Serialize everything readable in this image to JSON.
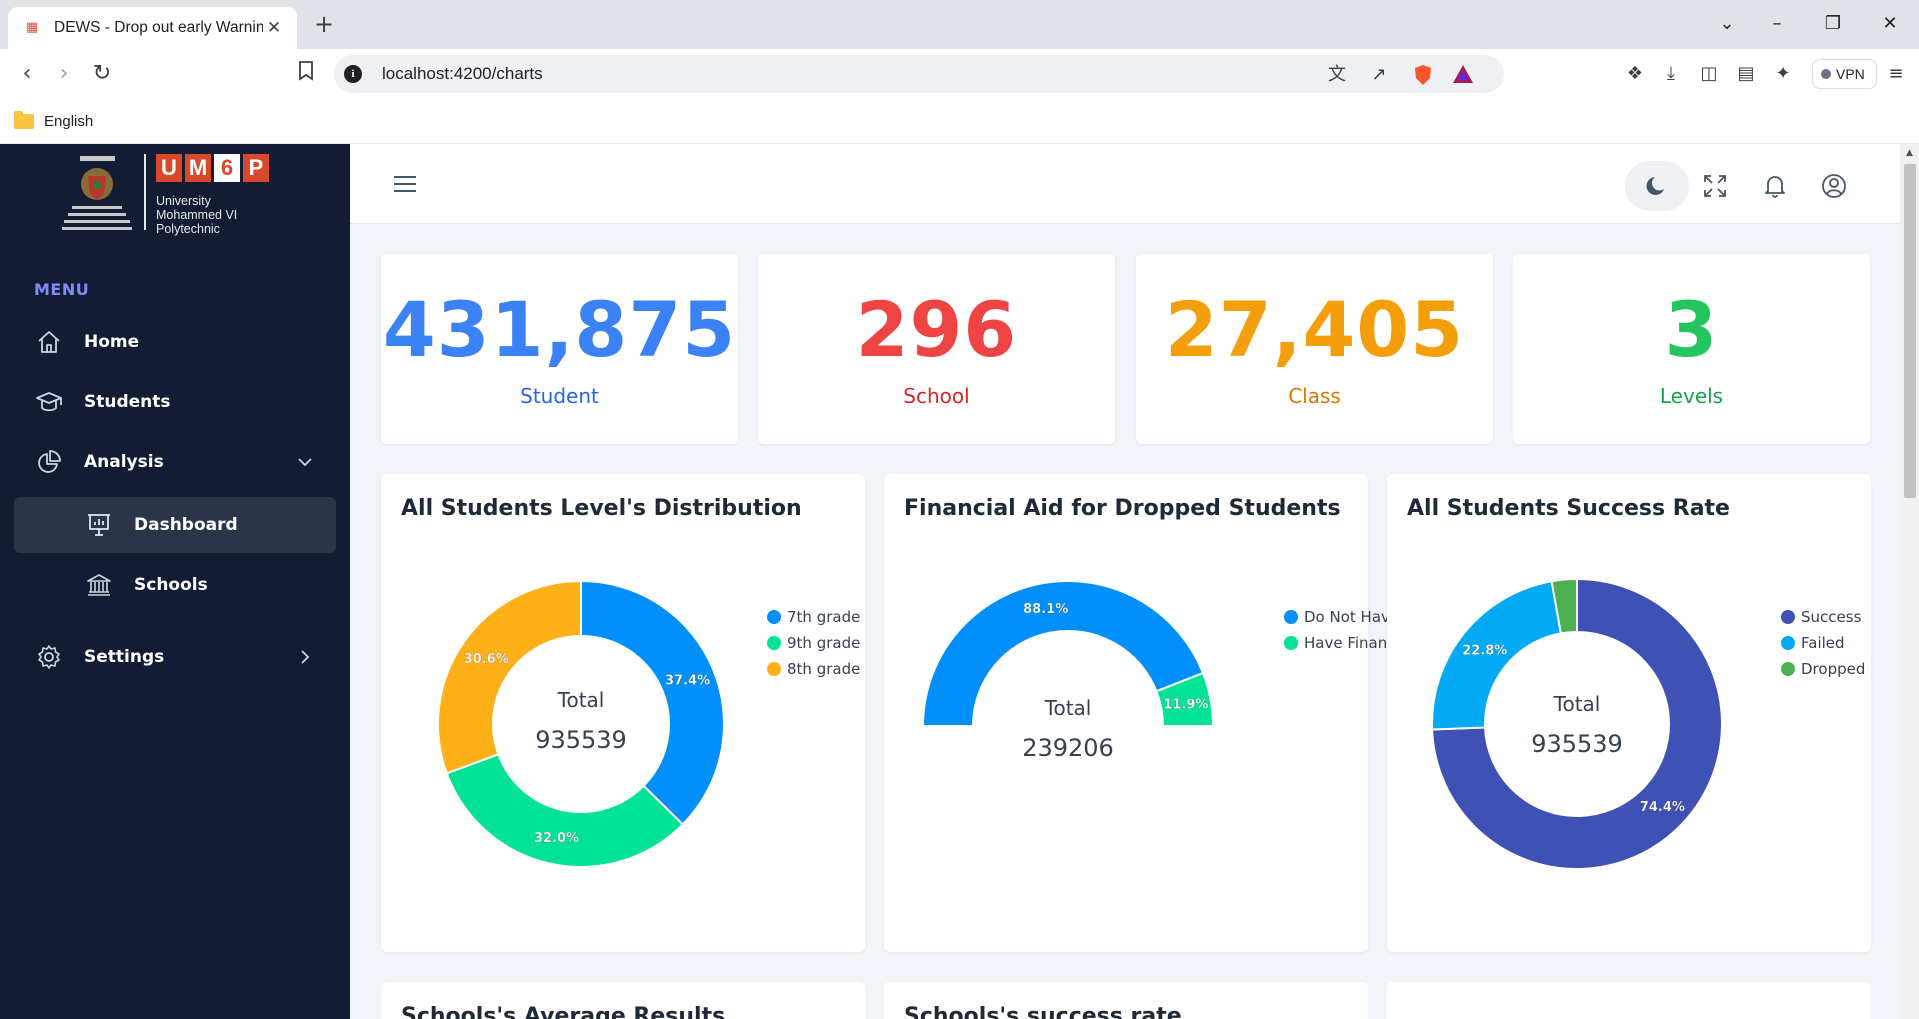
{
  "browser": {
    "tab_title": "DEWS - Drop out early Warning",
    "url": "localhost:4200/charts",
    "vpn_label": "VPN",
    "bookmark_folder": "English"
  },
  "sidebar": {
    "logo_letters": [
      "U",
      "M",
      "6",
      "P"
    ],
    "logo_text": [
      "University",
      "Mohammed VI",
      "Polytechnic"
    ],
    "menu_label": "MENU",
    "items": [
      {
        "label": "Home",
        "icon": "home-icon"
      },
      {
        "label": "Students",
        "icon": "graduation-cap-icon"
      },
      {
        "label": "Analysis",
        "icon": "pie-chart-icon"
      },
      {
        "label": "Dashboard",
        "icon": "presentation-chart-icon"
      },
      {
        "label": "Schools",
        "icon": "institution-icon"
      },
      {
        "label": "Settings",
        "icon": "gear-icon"
      }
    ]
  },
  "stats": [
    {
      "value": "431,875",
      "label": "Student",
      "color": "#3b82f6",
      "label_color": "#2563eb"
    },
    {
      "value": "296",
      "label": "School",
      "color": "#ef4444",
      "label_color": "#dc2626"
    },
    {
      "value": "27,405",
      "label": "Class",
      "color": "#f59e0b",
      "label_color": "#d97706"
    },
    {
      "value": "3",
      "label": "Levels",
      "color": "#22c55e",
      "label_color": "#16a34a"
    }
  ],
  "cards": {
    "levels": {
      "title": "All Students Level's Distribution",
      "center_title": "Total",
      "center_value": "935539"
    },
    "aid": {
      "title": "Financial Aid for Dropped Students",
      "center_title": "Total",
      "center_value": "239206"
    },
    "success": {
      "title": "All Students Success Rate",
      "center_title": "Total",
      "center_value": "935539"
    }
  },
  "bottom_cards": [
    "Schools's Average Results",
    "Schools's success rate",
    ""
  ],
  "chart_data": [
    {
      "type": "pie",
      "title": "All Students Level's Distribution",
      "categories": [
        "7th grade",
        "9th grade",
        "8th grade"
      ],
      "values": [
        37.4,
        32.0,
        30.6
      ],
      "labels": [
        "37.4%",
        "32.0%",
        "30.6%"
      ],
      "colors": [
        "#008ffb",
        "#00e396",
        "#feb019"
      ],
      "legend": "right"
    },
    {
      "type": "pie",
      "title": "Financial Aid for Dropped Students",
      "categories": [
        "Do Not Have Financial Aid",
        "Have Financial Aid"
      ],
      "values": [
        88.1,
        11.9
      ],
      "labels": [
        "88.1%",
        "11.9%"
      ],
      "colors": [
        "#008ffb",
        "#00e396"
      ],
      "legend": "right"
    },
    {
      "type": "pie",
      "title": "All Students Success Rate",
      "categories": [
        "Success",
        "Failed",
        "Dropped"
      ],
      "values": [
        74.4,
        22.8,
        2.8
      ],
      "labels": [
        "74.4%",
        "22.8%",
        ""
      ],
      "colors": [
        "#3f51b5",
        "#03a9f4",
        "#4caf50"
      ],
      "legend": "right"
    }
  ]
}
